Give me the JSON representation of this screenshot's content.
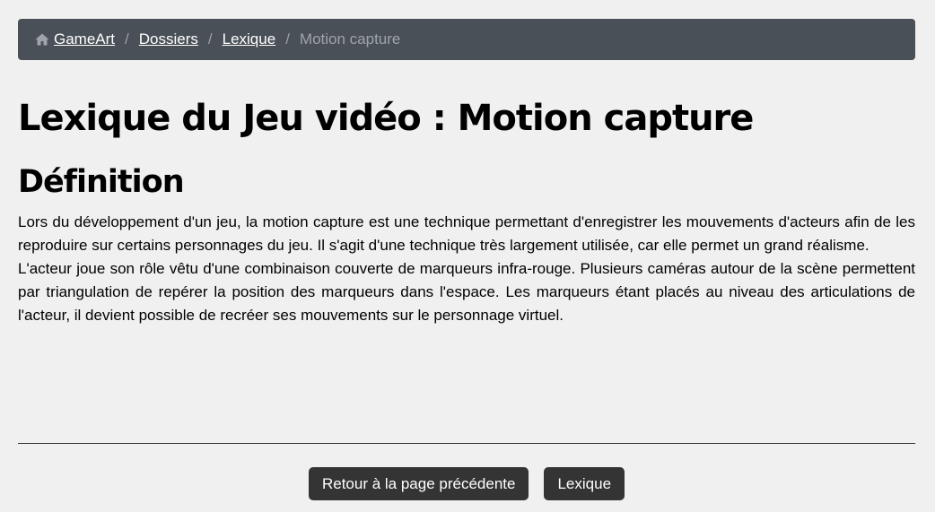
{
  "breadcrumb": {
    "home_icon": "home-icon",
    "items": [
      {
        "label": "GameArt"
      },
      {
        "label": "Dossiers"
      },
      {
        "label": "Lexique"
      }
    ],
    "current": "Motion capture",
    "separator": "/"
  },
  "page": {
    "title": "Lexique du Jeu vidéo : Motion capture",
    "section_heading": "Définition",
    "paragraphs": [
      "Lors du développement d'un jeu, la motion capture est une technique permettant d'enregistrer les mouvements d'acteurs afin de les reproduire sur certains personnages du jeu. Il s'agit d'une technique très largement utilisée, car elle permet un grand réalisme.",
      "L'acteur joue son rôle vêtu d'une combinaison couverte de marqueurs infra-rouge. Plusieurs caméras autour de la scène permettent par triangulation de repérer la position des marqueurs dans l'espace. Les marqueurs étant placés au niveau des articulations de l'acteur, il devient possible de recréer ses mouvements sur le personnage virtuel."
    ]
  },
  "footer": {
    "back_label": "Retour à la page précédente",
    "lexique_label": "Lexique"
  },
  "colors": {
    "background": "#f0f0f0",
    "breadcrumb_bg": "#495057",
    "button_bg": "#343434"
  }
}
